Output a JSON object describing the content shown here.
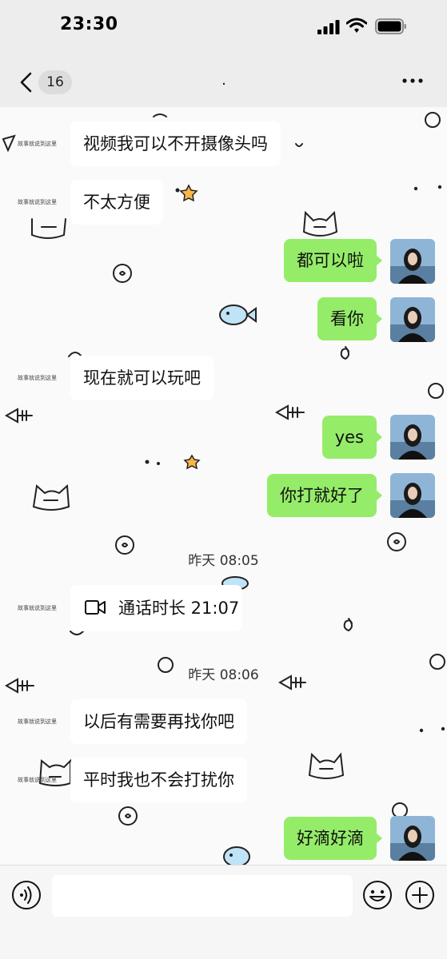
{
  "status_bar": {
    "time": "23:30"
  },
  "nav": {
    "unread_count": "16",
    "title": "."
  },
  "messages": [
    {
      "side": "left",
      "text": "视频我可以不开摄像头吗",
      "avatar_text": "故事就说到这里"
    },
    {
      "side": "left",
      "text": "不太方便",
      "avatar_text": "故事就说到这里"
    },
    {
      "side": "right",
      "text": "都可以啦"
    },
    {
      "side": "right",
      "text": "看你"
    },
    {
      "side": "left",
      "text": "现在就可以玩吧",
      "avatar_text": "故事就说到这里"
    },
    {
      "side": "right",
      "text": "yes"
    },
    {
      "side": "right",
      "text": "你打就好了"
    },
    {
      "type": "time",
      "text": "昨天 08:05"
    },
    {
      "type": "call",
      "text": "通话时长 21:07",
      "avatar_text": "故事就说到这里"
    },
    {
      "type": "time",
      "text": "昨天 08:06"
    },
    {
      "side": "left",
      "text": "以后有需要再找你吧",
      "avatar_text": "故事就说到这里"
    },
    {
      "side": "left",
      "text": "平时我也不会打扰你",
      "avatar_text": "故事就说到这里"
    },
    {
      "side": "right",
      "text": "好滴好滴"
    }
  ],
  "input": {
    "value": ""
  },
  "colors": {
    "bubble_self": "#95ec69",
    "bubble_other": "#ffffff",
    "background": "#ededed"
  },
  "icons": [
    "signal-icon",
    "wifi-icon",
    "battery-icon",
    "back-icon",
    "more-icon",
    "video-call-icon",
    "voice-icon",
    "emoji-icon",
    "plus-icon"
  ]
}
